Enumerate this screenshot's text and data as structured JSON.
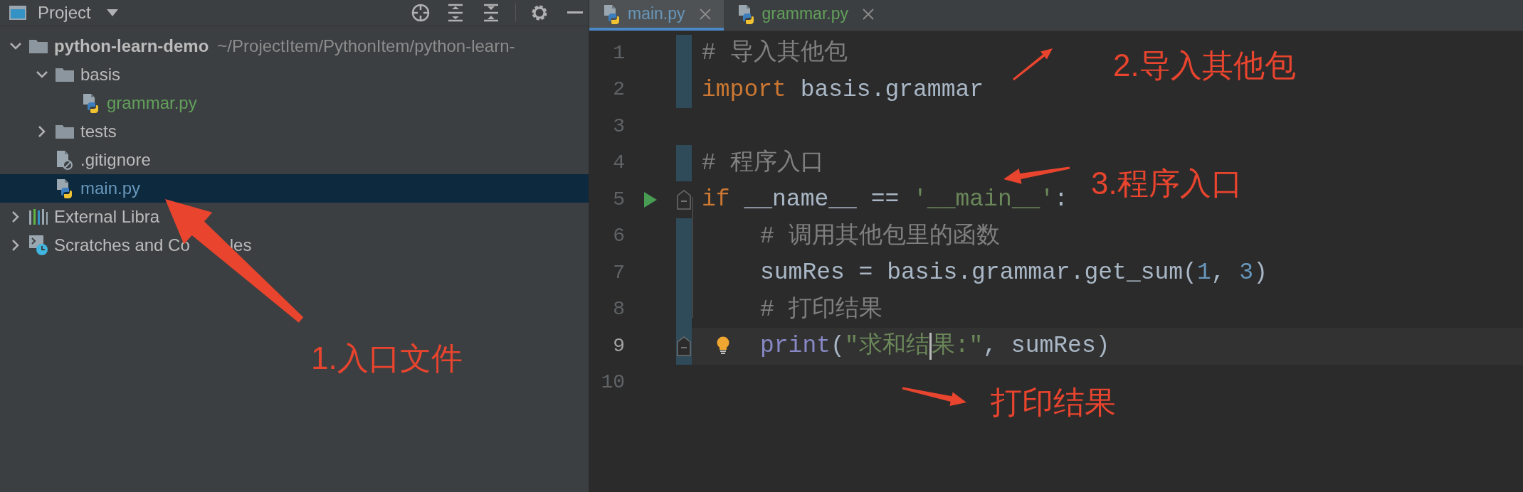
{
  "project_panel": {
    "title": "Project",
    "tree": [
      {
        "label": "python-learn-demo",
        "path": "~/ProjectItem/PythonItem/python-learn-",
        "kind": "folder",
        "color": "#bbbbbb",
        "expanded": true,
        "selected": false,
        "children": [
          {
            "label": "basis",
            "kind": "folder",
            "color": "#bbbbbb",
            "expanded": true,
            "selected": false,
            "children": [
              {
                "label": "grammar.py",
                "kind": "python",
                "color": "#62a05b",
                "selected": false
              }
            ]
          },
          {
            "label": "tests",
            "kind": "folder",
            "color": "#bbbbbb",
            "expanded": false,
            "selected": false
          },
          {
            "label": ".gitignore",
            "kind": "ignore",
            "color": "#bbbbbb",
            "selected": false
          },
          {
            "label": "main.py",
            "kind": "python",
            "color": "#6897bb",
            "selected": true
          }
        ]
      },
      {
        "label": "External Libra",
        "kind": "library",
        "color": "#bbbbbb",
        "expanded": false,
        "selected": false
      },
      {
        "label": "Scratches and Co",
        "label_tail": "les",
        "kind": "scratches",
        "color": "#bbbbbb",
        "expanded": false,
        "selected": false
      }
    ]
  },
  "editor": {
    "tabs": [
      {
        "label": "main.py",
        "color": "#6897bb",
        "selected": true
      },
      {
        "label": "grammar.py",
        "color": "#62a05b",
        "selected": false
      }
    ],
    "lines": [
      {
        "number": "1",
        "changed": true,
        "current": false,
        "indented": false,
        "tokens": [
          {
            "kind": "comment",
            "text": "# 导入其他包"
          }
        ]
      },
      {
        "number": "2",
        "changed": true,
        "current": false,
        "indented": false,
        "tokens": [
          {
            "kind": "keyword",
            "text": "import"
          },
          {
            "kind": "plain",
            "text": " basis.grammar"
          }
        ]
      },
      {
        "number": "3",
        "changed": false,
        "current": false
      },
      {
        "number": "4",
        "changed": true,
        "current": false,
        "indented": false,
        "tokens": [
          {
            "kind": "comment",
            "text": "# 程序入口"
          }
        ]
      },
      {
        "number": "5",
        "changed": false,
        "current": false,
        "indented": false,
        "run": true,
        "fold": true,
        "tokens": [
          {
            "kind": "keyword",
            "text": "if"
          },
          {
            "kind": "plain",
            "text": " __name__ == "
          },
          {
            "kind": "string",
            "text": "'__main__'"
          },
          {
            "kind": "plain",
            "text": ":"
          }
        ]
      },
      {
        "number": "6",
        "changed": true,
        "current": false,
        "indented": true,
        "tokens": [
          {
            "kind": "comment",
            "text": "# 调用其他包里的函数"
          }
        ]
      },
      {
        "number": "7",
        "changed": true,
        "current": false,
        "indented": true,
        "tokens": [
          {
            "kind": "plain",
            "text": "sumRes = basis.grammar.get_sum("
          },
          {
            "kind": "number",
            "text": "1"
          },
          {
            "kind": "plain",
            "text": ", "
          },
          {
            "kind": "number",
            "text": "3"
          },
          {
            "kind": "plain",
            "text": ")"
          }
        ]
      },
      {
        "number": "8",
        "changed": true,
        "current": false,
        "indented": true,
        "tokens": [
          {
            "kind": "comment",
            "text": "# 打印结果"
          }
        ]
      },
      {
        "number": "9",
        "changed": true,
        "current": true,
        "indented": true,
        "fold": true,
        "bulb": true,
        "tokens": [
          {
            "kind": "builtin",
            "text": "print"
          },
          {
            "kind": "plain",
            "text": "("
          },
          {
            "kind": "string",
            "text": "\"求和结",
            "caret": true
          },
          {
            "kind": "string",
            "text": "果:\""
          },
          {
            "kind": "plain",
            "text": ", sumRes)"
          }
        ]
      },
      {
        "number": "10",
        "changed": false,
        "current": false
      }
    ]
  },
  "annotations": [
    {
      "text": "1.入口文件"
    },
    {
      "text": "2.导入其他包"
    },
    {
      "text": "3.程序入口"
    },
    {
      "text": "打印结果"
    }
  ]
}
